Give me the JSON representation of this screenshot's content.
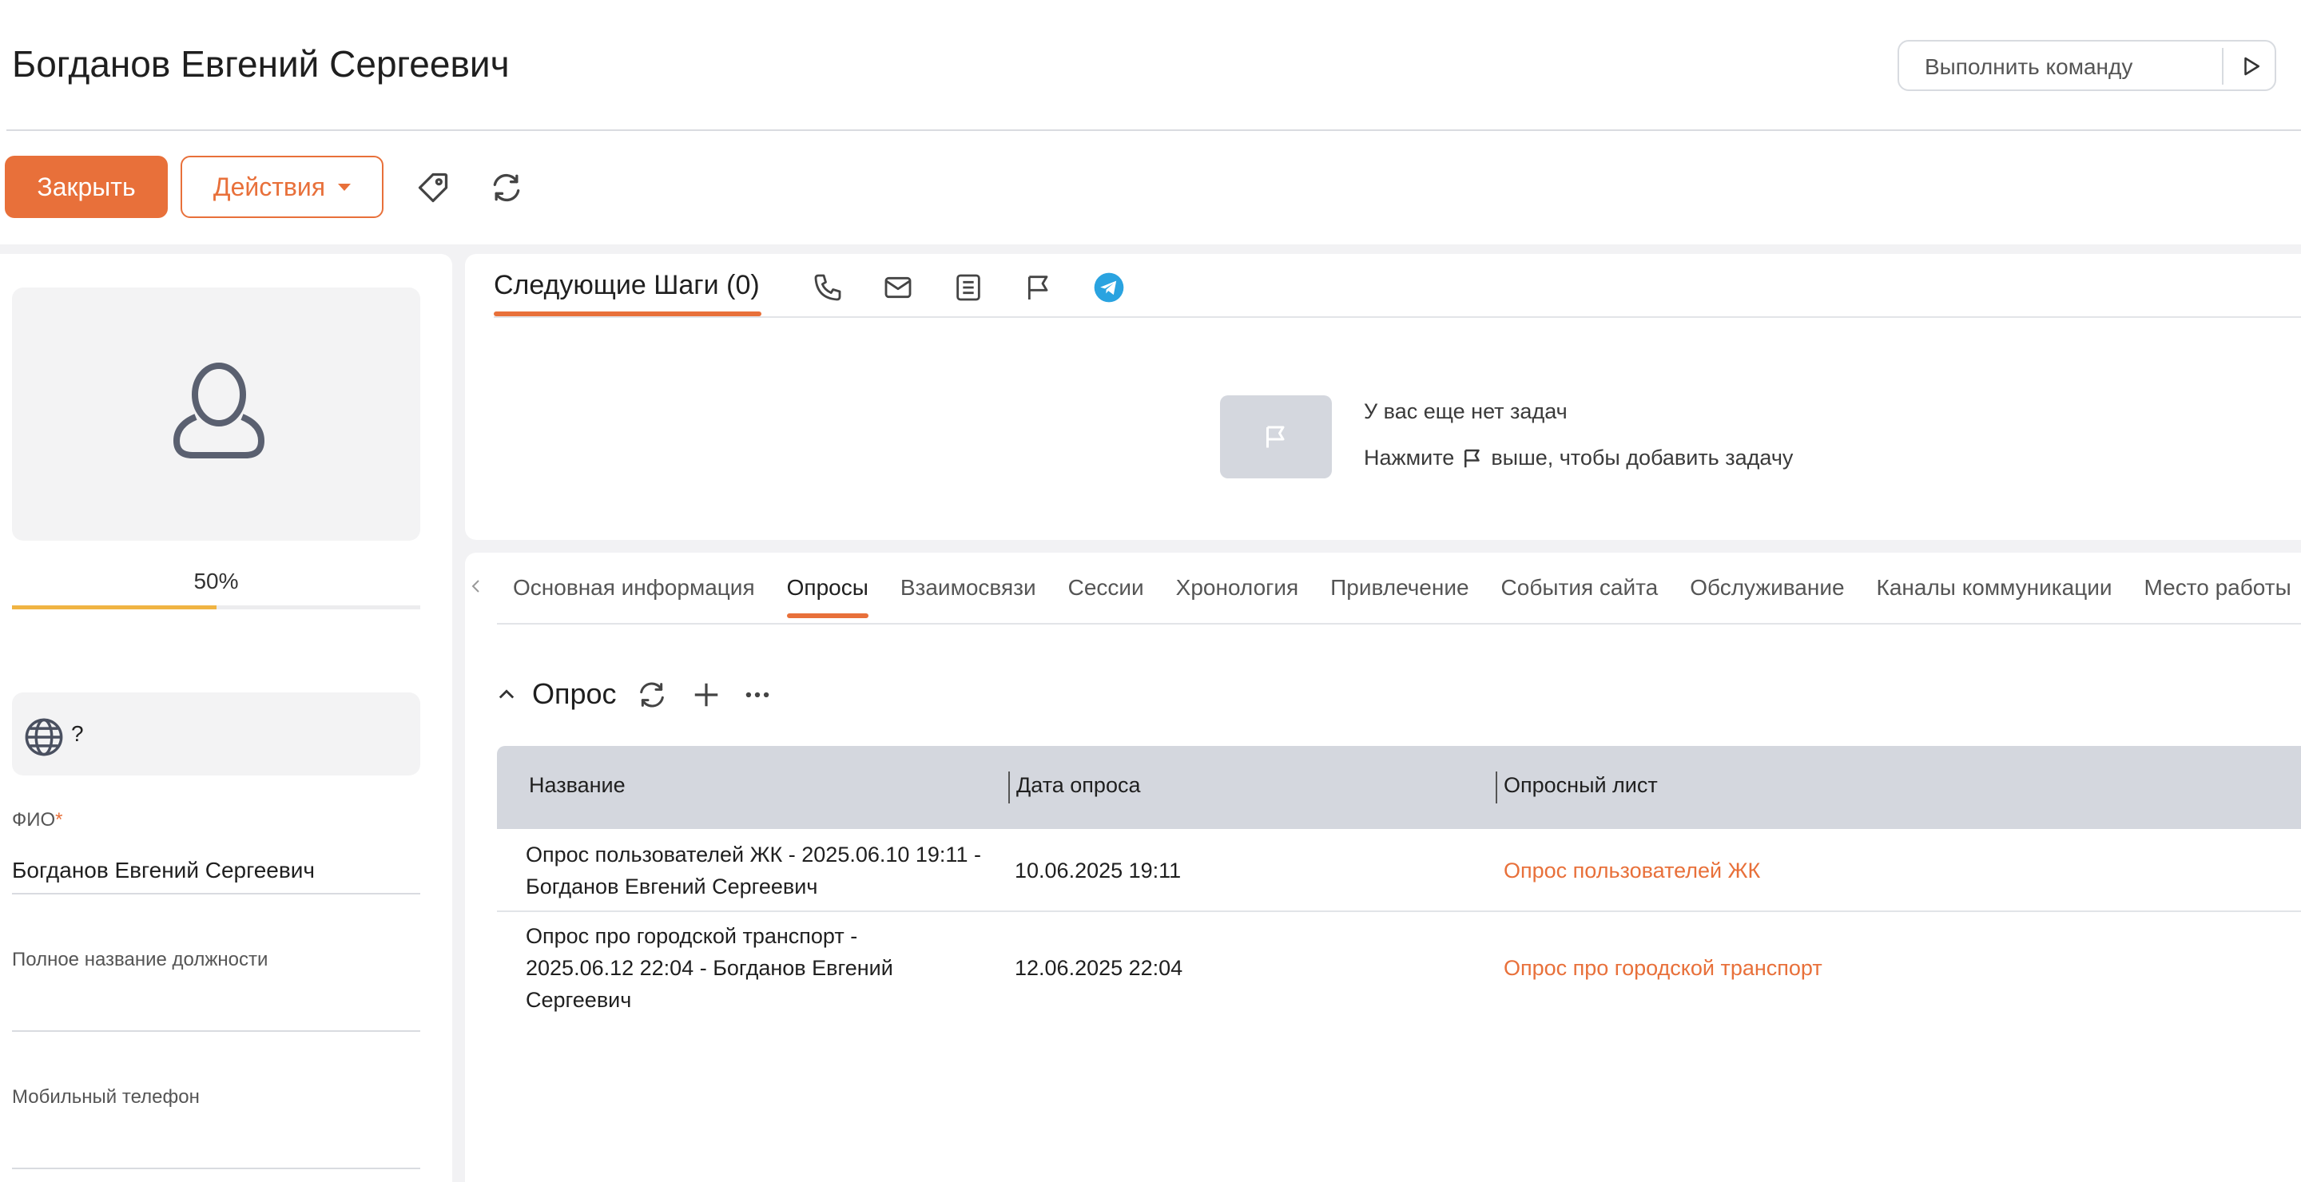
{
  "header": {
    "title": "Богданов Евгений Сергеевич",
    "command_placeholder": "Выполнить команду"
  },
  "toolbar": {
    "close_label": "Закрыть",
    "actions_label": "Действия"
  },
  "profile": {
    "completeness_percent": 50,
    "completeness_label": "50%",
    "language_value": "?",
    "fields": [
      {
        "label": "ФИО",
        "required_mark": "*",
        "value": "Богданов Евгений Сергеевич"
      },
      {
        "label": "Полное название должности",
        "value": ""
      },
      {
        "label": "Мобильный телефон",
        "value": ""
      }
    ]
  },
  "next_steps": {
    "title": "Следующие Шаги (0)",
    "empty_title": "У вас еще нет задач",
    "empty_hint_before": "Нажмите",
    "empty_hint_after": "выше, чтобы добавить задачу"
  },
  "tabs": [
    {
      "label": "Основная информация",
      "active": false
    },
    {
      "label": "Опросы",
      "active": true
    },
    {
      "label": "Взаимосвязи",
      "active": false
    },
    {
      "label": "Сессии",
      "active": false
    },
    {
      "label": "Хронология",
      "active": false
    },
    {
      "label": "Привлечение",
      "active": false
    },
    {
      "label": "События сайта",
      "active": false
    },
    {
      "label": "Обслуживание",
      "active": false
    },
    {
      "label": "Каналы коммуникации",
      "active": false
    },
    {
      "label": "Место работы",
      "active": false
    }
  ],
  "survey_section": {
    "title": "Опрос",
    "columns": [
      "Название",
      "Дата опроса",
      "Опросный лист"
    ],
    "rows": [
      {
        "name": "Опрос пользователей ЖК - 2025.06.10 19:11 - Богданов Евгений Сергеевич",
        "date": "10.06.2025 19:11",
        "sheet": "Опрос пользователей ЖК"
      },
      {
        "name": "Опрос про городской транспорт - 2025.06.12 22:04 - Богданов Евгений Сергеевич",
        "date": "12.06.2025 22:04",
        "sheet": "Опрос про городской транспорт"
      }
    ]
  },
  "colors": {
    "accent": "#e8703a",
    "progress": "#f0b443",
    "telegram": "#2aa3e0"
  }
}
